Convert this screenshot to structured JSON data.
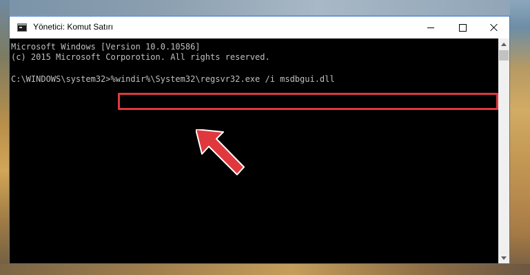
{
  "window": {
    "title": "Yönetici: Komut Satırı"
  },
  "console": {
    "line1": "Microsoft Windows [Version 10.0.10586]",
    "line2": "(c) 2015 Microsoft Corporotion. All rights reserved.",
    "prompt": "C:\\WINDOWS\\system32>",
    "command": "%windir%\\System32\\regsvr32.exe /i msdbgui.dll"
  },
  "colors": {
    "highlight": "#e0393d",
    "arrow": "#e0393d",
    "console_background": "#000000",
    "console_text": "#c0c0c0"
  },
  "icons": {
    "app": "console-icon",
    "minimize": "minimize-icon",
    "maximize": "maximize-icon",
    "close": "close-icon",
    "annotation": "arrow-icon"
  }
}
